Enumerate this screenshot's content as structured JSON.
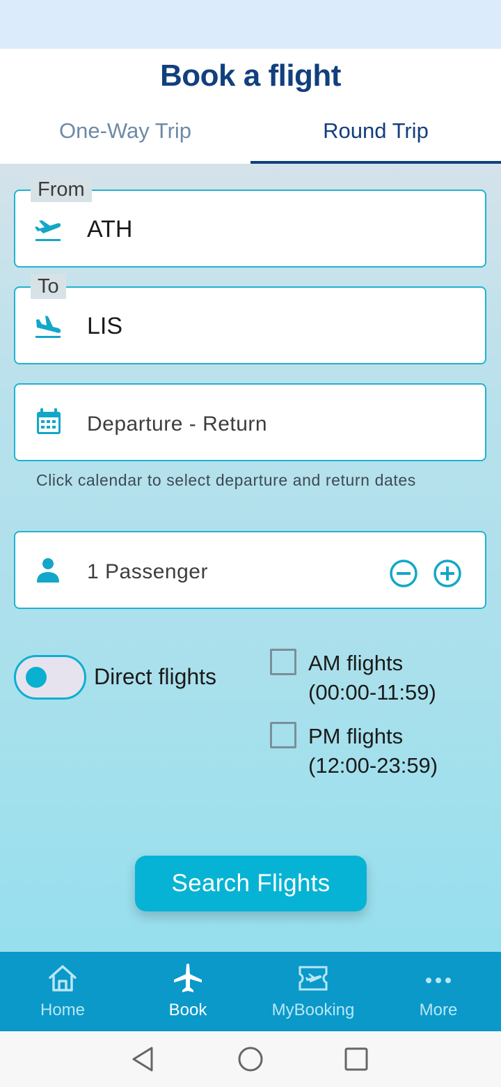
{
  "header": {
    "title": "Book a flight",
    "tabs": [
      {
        "label": "One-Way Trip",
        "active": false
      },
      {
        "label": "Round Trip",
        "active": true
      }
    ]
  },
  "form": {
    "from": {
      "label": "From",
      "value": "ATH",
      "icon": "flight-takeoff-icon"
    },
    "to": {
      "label": "To",
      "value": "LIS",
      "icon": "flight-land-icon"
    },
    "dates": {
      "placeholder": "Departure - Return",
      "icon": "calendar-icon",
      "hint": "Click calendar to select departure and return dates"
    },
    "passengers": {
      "value": "1 Passenger",
      "icon": "person-icon"
    },
    "direct_flights": {
      "label": "Direct flights",
      "on": false
    },
    "am_flights": {
      "label_line1": "AM flights",
      "label_line2": "(00:00-11:59)",
      "checked": false
    },
    "pm_flights": {
      "label_line1": "PM flights",
      "label_line2": "(12:00-23:59)",
      "checked": false
    },
    "search_label": "Search Flights"
  },
  "bottom_nav": [
    {
      "label": "Home",
      "icon": "home-icon",
      "active": false
    },
    {
      "label": "Book",
      "icon": "airplane-icon",
      "active": true
    },
    {
      "label": "MyBooking",
      "icon": "ticket-icon",
      "active": false
    },
    {
      "label": "More",
      "icon": "more-dots-icon",
      "active": false
    }
  ],
  "colors": {
    "primary": "#123f7d",
    "accent": "#06b3d4",
    "nav_bg": "#0a99c9"
  }
}
